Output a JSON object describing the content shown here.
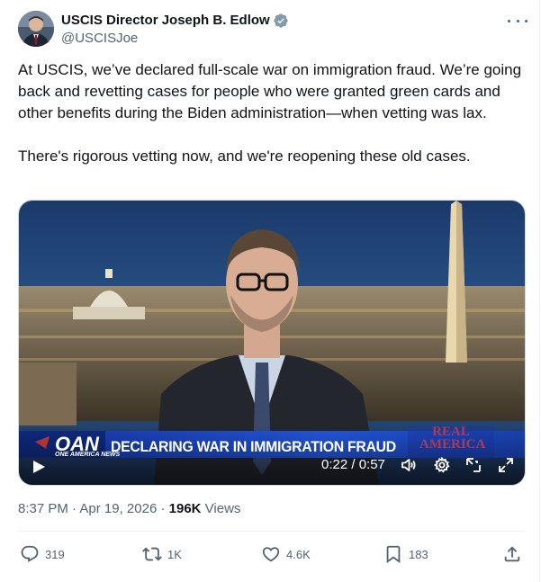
{
  "author": {
    "display_name": "USCIS Director Joseph B. Edlow",
    "handle": "@USCISJoe",
    "verified_badge": "verified-gray-badge",
    "avatar": "avatar-photo"
  },
  "tweet": {
    "paragraphs": [
      "At USCIS, we’ve declared full-scale war on immigration fraud. We’re going back and revetting cases for people who were granted green cards and other benefits during the Biden administration—when vetting was lax.",
      "There's rigorous vetting now, and we're reopening these old cases."
    ]
  },
  "video": {
    "chyron_text": "DECLARING WAR IN IMMIGRATION FRAUD",
    "network_logo": "OAN",
    "network_subtext": "ONE AMERICA NEWS",
    "show_logo": "REAL AMERICA",
    "time_display": "0:22 / 0:57",
    "controls": [
      "play-icon",
      "volume-icon",
      "settings-gear-icon",
      "picture-in-picture-icon",
      "fullscreen-icon"
    ]
  },
  "meta": {
    "time": "8:37 PM",
    "separator": " · ",
    "date": "Apr 19, 2026",
    "views_count": "196K",
    "views_label": " Views"
  },
  "actions": {
    "reply_count": "319",
    "repost_count": "1K",
    "like_count": "4.6K",
    "bookmark_count": "183"
  },
  "colors": {
    "text_primary": "#0f1419",
    "text_secondary": "#536471",
    "divider": "#eff3f4",
    "chyron_blue": "#1f4fd0"
  }
}
